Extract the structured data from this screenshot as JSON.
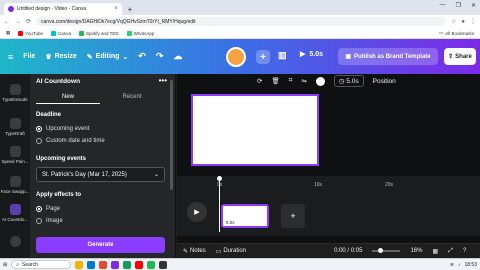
{
  "browser": {
    "tab_title": "Untitled design - Video - Canva",
    "tab_close": "×",
    "new_tab": "+",
    "window_controls": [
      "—",
      "❐",
      "✕"
    ],
    "url": "canva.com/design/DAGHiDk7ecg/VqQGHvSzmT0rYt_RMY/Hqug/edit",
    "bookmarks": [
      {
        "label": "YouTube",
        "color": "#ff0000"
      },
      {
        "label": "Canva",
        "color": "#00c4cc"
      },
      {
        "label": "Spotify and TED",
        "color": "#1db954"
      },
      {
        "label": "WhatsApp",
        "color": "#25d366"
      }
    ],
    "all_bookmarks": "All Bookmarks"
  },
  "header": {
    "file": "File",
    "resize": "Resize",
    "editing": "Editing",
    "undo_icon": "undo-icon",
    "redo_icon": "redo-icon",
    "cloud_icon": "cloud-icon",
    "plus": "+",
    "play_time": "5.0s",
    "publish": "Publish as Brand Template",
    "share": "Share"
  },
  "rail": {
    "items": [
      "TypeExtrude",
      "TypeDraft",
      "Speed Pain...",
      "Face Swapp...",
      "AI Countdo...",
      ""
    ]
  },
  "panel": {
    "title": "AI Countdown",
    "more": "•••",
    "tabs": [
      "New",
      "Recent"
    ],
    "active_tab": "New",
    "deadline_label": "Deadline",
    "deadline_options": [
      {
        "label": "Upcoming event",
        "selected": true
      },
      {
        "label": "Custom date and time",
        "selected": false
      }
    ],
    "upcoming_label": "Upcoming events",
    "upcoming_value": "St. Patrick's Day (Mar 17, 2025)",
    "apply_label": "Apply effects to",
    "apply_options": [
      {
        "label": "Page",
        "selected": true
      },
      {
        "label": "Image",
        "selected": false
      }
    ],
    "generate": "Generate"
  },
  "toolbar": {
    "duration": "5.0s",
    "position": "Position"
  },
  "timeline": {
    "ticks": [
      "0s",
      "10s",
      "20s"
    ],
    "clip_label": "5.0s",
    "add": "+"
  },
  "bottombar": {
    "notes": "Notes",
    "duration": "Duration",
    "time": "0:00 / 0:05",
    "zoom": "16%"
  },
  "taskbar": {
    "search": "Search",
    "apps": [
      "#f4b400",
      "#0078d4",
      "#e34c26",
      "#7d2ae8",
      "#0f9d58",
      "#ff0000",
      "#1db954",
      "#333333"
    ],
    "clock": "18:53"
  }
}
